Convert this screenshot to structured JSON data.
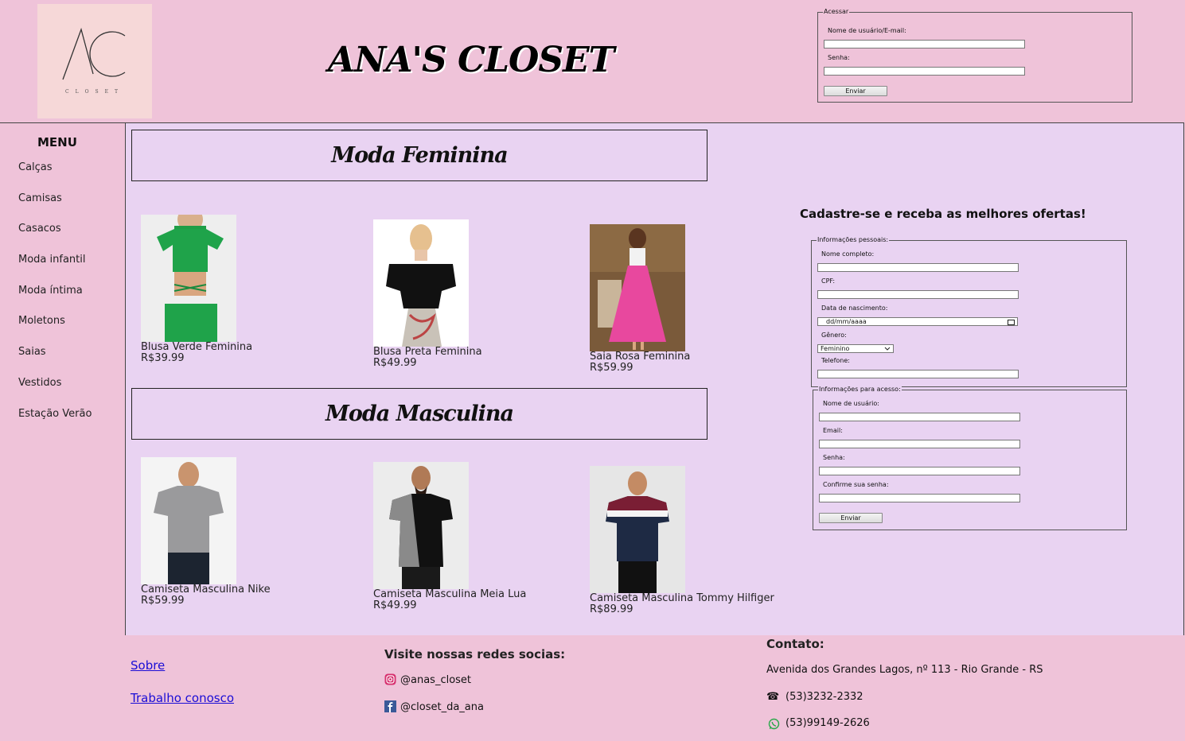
{
  "header": {
    "logo_text": "CLOSET",
    "site_title": "ANA'S CLOSET"
  },
  "login": {
    "legend": "Acessar",
    "username_label": "Nome de usuário/E-mail:",
    "password_label": "Senha:",
    "submit_label": "Enviar"
  },
  "menu": {
    "title": "MENU",
    "items": [
      {
        "label": "Calças"
      },
      {
        "label": "Camisas"
      },
      {
        "label": "Casacos"
      },
      {
        "label": "Moda infantil"
      },
      {
        "label": "Moda íntima"
      },
      {
        "label": "Moletons"
      },
      {
        "label": "Saias"
      },
      {
        "label": "Vestidos"
      },
      {
        "label": "Estação Verão"
      }
    ]
  },
  "sections": {
    "female_title": "Moda Feminina",
    "male_title": "Moda Masculina"
  },
  "products": {
    "female": [
      {
        "name": "Blusa Verde Feminina",
        "price": "R$39.99"
      },
      {
        "name": "Blusa Preta Feminina",
        "price": "R$49.99"
      },
      {
        "name": "Saia Rosa Feminina",
        "price": "R$59.99"
      }
    ],
    "male": [
      {
        "name": "Camiseta Masculina Nike",
        "price": "R$59.99"
      },
      {
        "name": "Camiseta Masculina Meia Lua",
        "price": "R$49.99"
      },
      {
        "name": "Camiseta Masculina Tommy Hilfiger",
        "price": "R$89.99"
      }
    ]
  },
  "signup": {
    "title": "Cadastre-se e receba as melhores ofertas!",
    "personal_legend": "Informações pessoais:",
    "full_name_label": "Nome completo:",
    "cpf_label": "CPF:",
    "birth_label": "Data de nascimento:",
    "birth_placeholder": "dd/mm/aaaa",
    "gender_label": "Gênero:",
    "gender_value": "Feminino",
    "phone_label": "Telefone:",
    "access_legend": "Informações para acesso:",
    "username_label": "Nome de usuário:",
    "email_label": "Email:",
    "password_label": "Senha:",
    "confirm_label": "Confirme sua senha:",
    "submit_label": "Enviar"
  },
  "footer": {
    "about_link": "Sobre",
    "work_link": "Trabalho conosco",
    "social_title": "Visite nossas redes socias:",
    "instagram": "@anas_closet",
    "facebook": "@closet_da_ana",
    "contact_title": "Contato:",
    "address": "Avenida dos Grandes Lagos, nº 113 - Rio Grande - RS",
    "phone": "(53)3232-2332",
    "whatsapp": "(53)99149-2626"
  },
  "colors": {
    "background_pink": "#efc3d9",
    "main_lavender": "#e9d3f2",
    "link_blue": "#1a0dd6"
  }
}
